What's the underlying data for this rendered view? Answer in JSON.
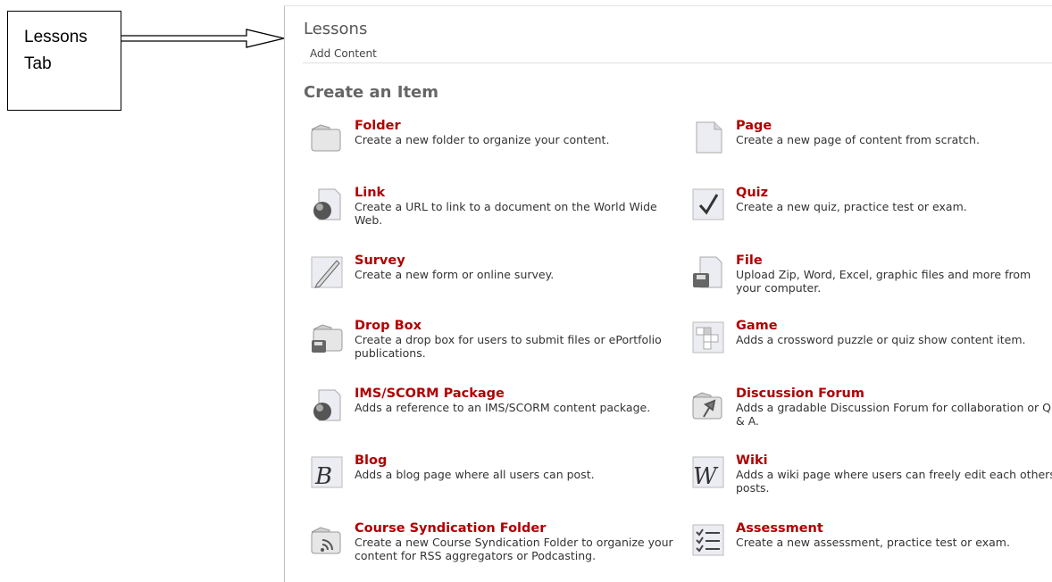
{
  "callout": {
    "line1": "Lessons",
    "line2": "Tab"
  },
  "panel": {
    "title": "Lessons",
    "subtitle": "Add Content"
  },
  "section": {
    "heading": "Create an Item"
  },
  "items": [
    {
      "name": "Folder",
      "desc": "Create a new folder to organize your content.",
      "icon": "folder-icon"
    },
    {
      "name": "Page",
      "desc": "Create a new page of content from scratch.",
      "icon": "page-icon"
    },
    {
      "name": "Link",
      "desc": "Create a URL to link to a document on the World Wide Web.",
      "icon": "link-globe-icon"
    },
    {
      "name": "Quiz",
      "desc": "Create a new quiz, practice test or exam.",
      "icon": "quiz-checkmark-icon"
    },
    {
      "name": "Survey",
      "desc": "Create a new form or online survey.",
      "icon": "survey-pencil-icon"
    },
    {
      "name": "File",
      "desc": "Upload Zip, Word, Excel, graphic files and more from your computer.",
      "icon": "file-disk-icon"
    },
    {
      "name": "Drop Box",
      "desc": "Create a drop box for users to submit files or ePortfolio publications.",
      "icon": "drop-box-icon"
    },
    {
      "name": "Game",
      "desc": "Adds a crossword puzzle or quiz show content item.",
      "icon": "game-grid-icon"
    },
    {
      "name": "IMS/SCORM Package",
      "desc": "Adds a reference to an IMS/SCORM content package.",
      "icon": "package-globe-icon"
    },
    {
      "name": "Discussion Forum",
      "desc": "Adds a gradable Discussion Forum for collaboration or Q & A.",
      "icon": "discussion-pin-icon"
    },
    {
      "name": "Blog",
      "desc": "Adds a blog page where all users can post.",
      "icon": "blog-b-icon"
    },
    {
      "name": "Wiki",
      "desc": "Adds a wiki page where users can freely edit each others posts.",
      "icon": "wiki-w-icon"
    },
    {
      "name": "Course Syndication Folder",
      "desc": "Create a new Course Syndication Folder to organize your content for RSS aggregators or Podcasting.",
      "icon": "syndication-rss-icon"
    },
    {
      "name": "Assessment",
      "desc": "Create a new assessment, practice test or exam.",
      "icon": "assessment-list-icon"
    }
  ]
}
